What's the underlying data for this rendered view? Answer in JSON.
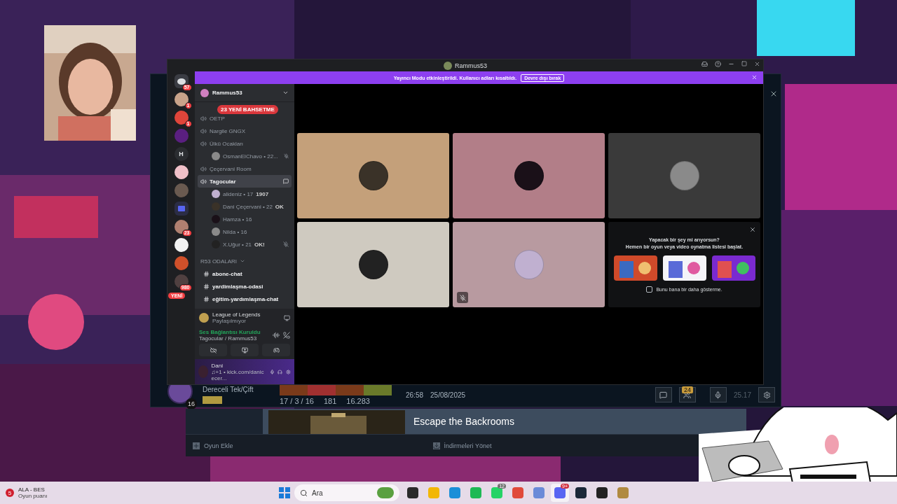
{
  "discord": {
    "title": "Rammus53",
    "notice": {
      "text": "Yayıncı Modu etkinleştirildi. Kullanıcı adları kısaltıldı.",
      "button": "Devre dışı bırak"
    },
    "servers": [
      {
        "kind": "home",
        "badge": "57",
        "color": "#3a3c43"
      },
      {
        "kind": "avatar",
        "badge": "1",
        "color": "#c9a38a"
      },
      {
        "kind": "avatar",
        "badge": "1",
        "color": "#e0453a"
      },
      {
        "kind": "avatar",
        "color": "#5a1f80"
      },
      {
        "kind": "letter",
        "label": "H",
        "color": "#2b2d31"
      },
      {
        "kind": "avatar",
        "color": "#f0c0c8"
      },
      {
        "kind": "avatar",
        "color": "#6a5a50"
      },
      {
        "kind": "folder",
        "color": "#2b2d45"
      },
      {
        "kind": "avatar",
        "badge": "23",
        "color": "#b08070"
      },
      {
        "kind": "avatar",
        "color": "#f2f2f2"
      },
      {
        "kind": "avatar",
        "color": "#d0502a"
      },
      {
        "kind": "avatar",
        "badge": "980",
        "color": "#504040"
      }
    ],
    "new_pill": "YENİ",
    "server_name": "Rammus53",
    "mentions_pill": "23 YENİ BAHSETME",
    "channels": [
      {
        "kind": "voice",
        "name": "OETP",
        "selected": false
      },
      {
        "kind": "voice",
        "name": "Nargile GNGX",
        "selected": false
      },
      {
        "kind": "voice",
        "name": "Ülkü Ocakları",
        "selected": false,
        "children": [
          {
            "name": "OsmanElChavo • 22...",
            "muted": true
          }
        ]
      },
      {
        "kind": "voice",
        "name": "Çeçervani Room",
        "selected": false
      },
      {
        "kind": "voice",
        "name": "Tagocular",
        "selected": true,
        "children": [
          {
            "name": "alideniz • 17",
            "status": "1907",
            "muted": false
          },
          {
            "name": "Dani Çeçervani • 22",
            "status": "OK",
            "muted": false
          },
          {
            "name": "Hamza • 16",
            "muted": false
          },
          {
            "name": "Nilda • 16",
            "muted": false
          },
          {
            "name": "X.Uğur • 21",
            "status": "OK!",
            "muted": true
          }
        ]
      }
    ],
    "category": {
      "name": "R53 ODALARI",
      "channels": [
        "abone-chat",
        "yardimlaşma-odasi",
        "eğitim-yardımlaşma-chat"
      ]
    },
    "activity": {
      "game": "League of Legends",
      "state": "Paylaşılmıyor"
    },
    "voice": {
      "status": "Ses Bağlantısı Kuruldu",
      "channel": "Tagocular  / Rammus53"
    },
    "user": {
      "name": "Dani",
      "status": "♫+1 • kick.com/danicecer..."
    },
    "tiles": [
      {
        "color": "#c4a07a",
        "muted": false
      },
      {
        "color": "#b27e88",
        "muted": false
      },
      {
        "color": "#3a3a3a",
        "muted": false
      },
      {
        "color": "#cfcac0",
        "muted": false
      },
      {
        "color": "#b89aa0",
        "muted": true
      }
    ],
    "suggest": {
      "title": "Yapacak bir şey mi arıyorsun?",
      "subtitle": "Hemen bir oyun veya video oynatma listesi başlat.",
      "checkbox": {
        "label": "Bunu bana bir daha gösterme.",
        "checked": false
      }
    }
  },
  "lol": {
    "queue": "Dereceli Tek/Çift",
    "level": "16",
    "kda": "17 / 3 / 16",
    "cs": "181",
    "gold": "16.283",
    "duration": "26:58",
    "date": "25/08/2025",
    "count": "24",
    "time": "25.17"
  },
  "steam": {
    "game": "Escape the Backrooms",
    "add": "Oyun Ekle",
    "downloads": "İndirmeleri Yönet"
  },
  "taskbar": {
    "weather": {
      "badge": "5",
      "title": "ALA - BES",
      "subtitle": "Oyun puanı"
    },
    "search": {
      "placeholder": "Ara"
    },
    "apps": [
      {
        "color": "#2a2a2a",
        "selected": false
      },
      {
        "color": "#f2b705",
        "selected": false
      },
      {
        "color": "#1a8fd8",
        "selected": false
      },
      {
        "color": "#1db954",
        "selected": false
      },
      {
        "color": "#25d366",
        "badge": "12",
        "selected": false
      },
      {
        "color": "#e04a3a",
        "selected": false
      },
      {
        "color": "#6a8ad8",
        "selected": false
      },
      {
        "color": "#5865f2",
        "badge": "9+",
        "selected": true
      },
      {
        "color": "#1b2838",
        "selected": false
      },
      {
        "color": "#222222",
        "selected": false
      },
      {
        "color": "#b08a40",
        "selected": false
      }
    ]
  }
}
